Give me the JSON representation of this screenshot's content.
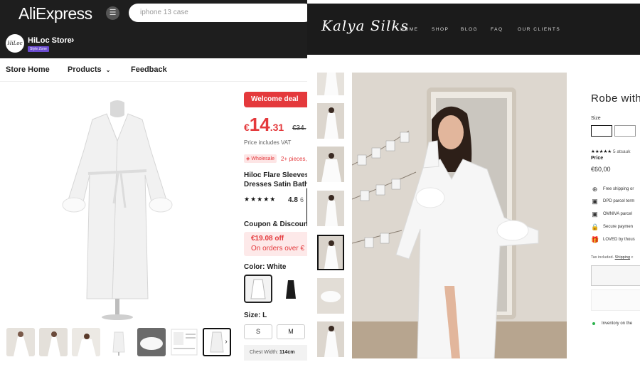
{
  "aliexpress": {
    "logo": "AliExpress",
    "search_placeholder": "iphone 13 case",
    "store": {
      "avatar_text": "HiLoc",
      "name": "HiLoc Store",
      "badge": "Style Zone"
    },
    "nav": {
      "home": "Store Home",
      "products": "Products",
      "feedback": "Feedback"
    },
    "thumb_count": 7,
    "product": {
      "welcome_deal": "Welcome deal",
      "currency": "€",
      "price_int": "14",
      "price_dec": ".31",
      "old_price": "€34.",
      "vat_note": "Price includes VAT",
      "wholesale_badge": "Wholesale",
      "wholesale_note": "2+ pieces,",
      "title": "Hiloc Flare Sleeves Dresses Satin Bath",
      "stars": "★★★★★",
      "rating": "4.8",
      "rating_extra": "6",
      "coupon_title": "Coupon & Discoun",
      "coupon_off": "€19.08 off",
      "coupon_condition": "On orders over €",
      "color_label": "Color: White",
      "size_label": "Size: L",
      "sizes": [
        "S",
        "M"
      ],
      "chest_label": "Chest Width:",
      "chest_value": "114cm"
    }
  },
  "kalya": {
    "logo": "Kalya Silks",
    "nav": [
      "HOME",
      "SHOP",
      "BLOG",
      "FAQ",
      "OUR CLIENTS"
    ],
    "product": {
      "title": "Robe with",
      "size_label": "Size",
      "stars": "★★★★★",
      "reviews": "5 atsauk",
      "price_label": "Price",
      "price": "€60,00",
      "features": [
        {
          "icon": "globe-icon",
          "glyph": "⊕",
          "text": "Free shipping or"
        },
        {
          "icon": "package-icon",
          "glyph": "▣",
          "text": "DPD parcel term"
        },
        {
          "icon": "package-icon",
          "glyph": "▣",
          "text": "OMNIVA parcel"
        },
        {
          "icon": "lock-icon",
          "glyph": "🔒",
          "text": "Secure paymen"
        },
        {
          "icon": "gift-icon",
          "glyph": "🎁",
          "text": "LOVED by thous"
        }
      ],
      "tax_note": "Tax included.",
      "shipping_link": "Shipping",
      "shipping_rest": "c",
      "inventory": "Inventory on the"
    }
  }
}
